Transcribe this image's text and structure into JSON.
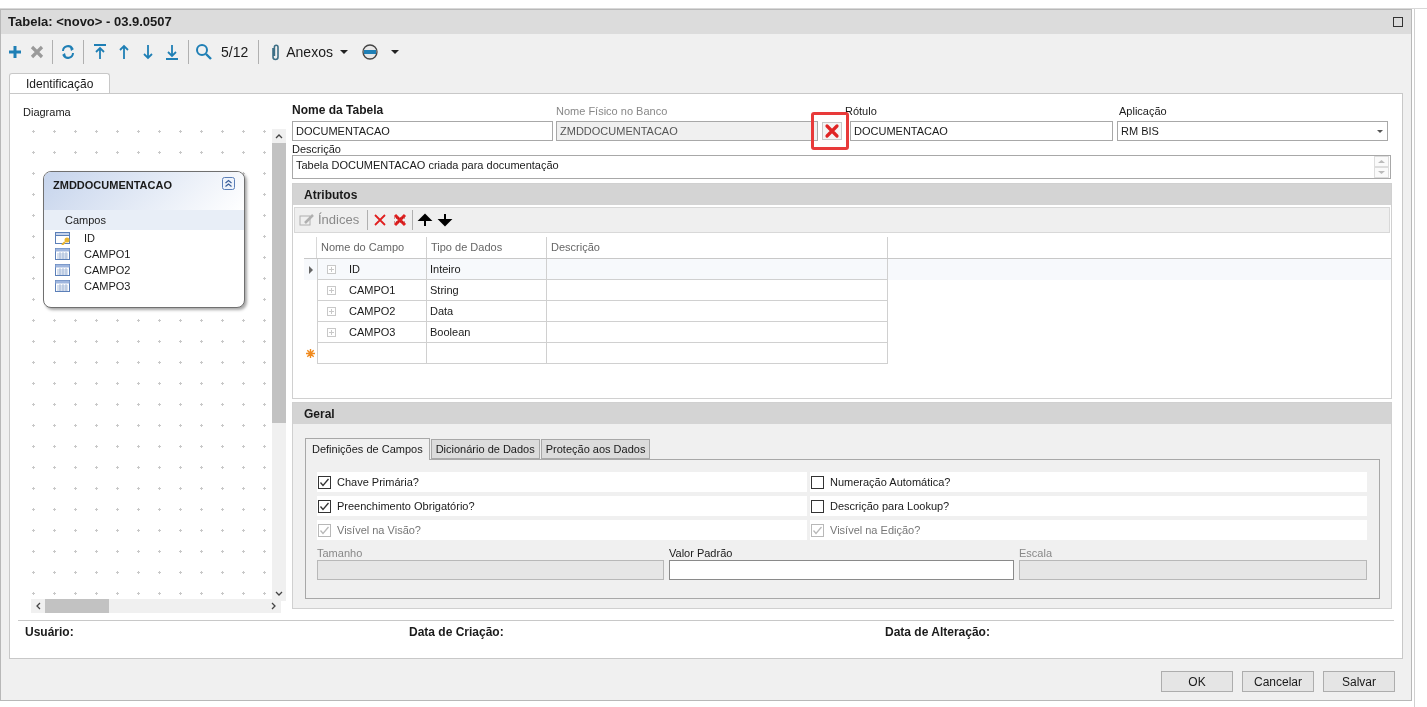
{
  "window": {
    "title": "Tabela: <novo> - 03.9.0507"
  },
  "toolbar": {
    "counter": "5/12",
    "attachments": "Anexos"
  },
  "tabs": [
    {
      "label": "Identificação",
      "selected": true
    }
  ],
  "diagram": {
    "label": "Diagrama",
    "entity": {
      "name": "ZMDDOCUMENTACAO",
      "section": "Campos",
      "fields": [
        {
          "name": "ID",
          "kind": "key"
        },
        {
          "name": "CAMPO1",
          "kind": "field"
        },
        {
          "name": "CAMPO2",
          "kind": "field"
        },
        {
          "name": "CAMPO3",
          "kind": "field"
        }
      ]
    }
  },
  "form": {
    "table_name": {
      "label": "Nome da Tabela",
      "value": "DOCUMENTACAO"
    },
    "physical_name": {
      "label": "Nome Físico no Banco",
      "value": "ZMDDOCUMENTACAO",
      "disabled": true
    },
    "caption": {
      "label": "Rótulo",
      "value": "DOCUMENTACAO"
    },
    "application": {
      "label": "Aplicação",
      "value": "RM BIS"
    },
    "description": {
      "label": "Descrição",
      "value": "Tabela DOCUMENTACAO criada para documentação"
    }
  },
  "attributes": {
    "title": "Atributos",
    "indexes_button": "Índices",
    "columns": [
      "Nome do Campo",
      "Tipo de Dados",
      "Descrição"
    ],
    "rows": [
      {
        "name": "ID",
        "type": "Inteiro",
        "selected": true
      },
      {
        "name": "CAMPO1",
        "type": "String",
        "selected": false
      },
      {
        "name": "CAMPO2",
        "type": "Data",
        "selected": false
      },
      {
        "name": "CAMPO3",
        "type": "Boolean",
        "selected": false
      }
    ]
  },
  "general": {
    "title": "Geral",
    "tabs": [
      {
        "label": "Definições de Campos",
        "selected": true
      },
      {
        "label": "Dicionário de Dados",
        "selected": false
      },
      {
        "label": "Proteção aos Dados",
        "selected": false
      }
    ],
    "checkboxes": [
      {
        "label": "Chave Primária?",
        "checked": true,
        "disabled": false
      },
      {
        "label": "Numeração Automática?",
        "checked": false,
        "disabled": false
      },
      {
        "label": "Preenchimento Obrigatório?",
        "checked": true,
        "disabled": false
      },
      {
        "label": "Descrição para Lookup?",
        "checked": false,
        "disabled": false
      },
      {
        "label": "Visível na Visão?",
        "checked": true,
        "disabled": true
      },
      {
        "label": "Visível na Edição?",
        "checked": true,
        "disabled": true
      }
    ],
    "inputs": [
      {
        "label": "Tamanho",
        "disabled": true
      },
      {
        "label": "Valor Padrão",
        "disabled": false
      },
      {
        "label": "Escala",
        "disabled": true
      }
    ]
  },
  "footer": [
    "Usuário:",
    "Data de Criação:",
    "Data de Alteração:"
  ],
  "buttons": [
    "OK",
    "Cancelar",
    "Salvar"
  ]
}
